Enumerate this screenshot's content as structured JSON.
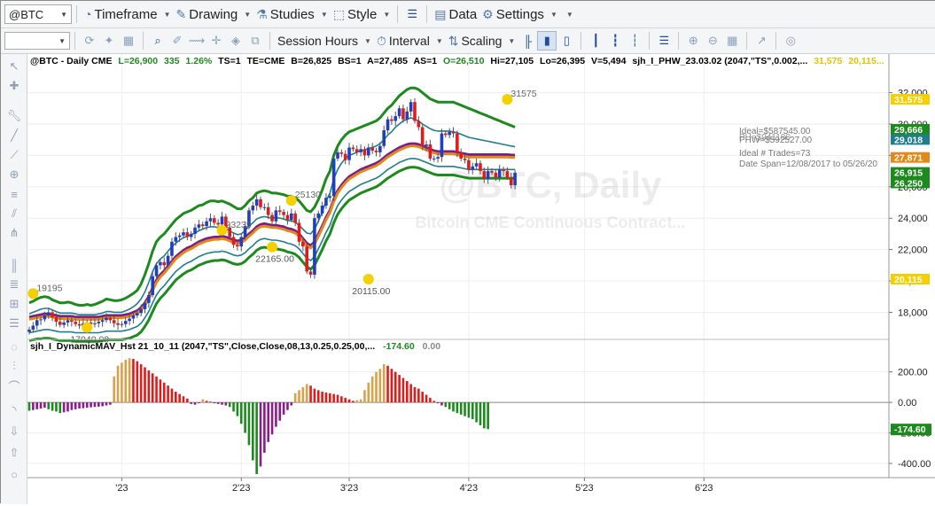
{
  "toolbar1": {
    "symbol": "@BTC",
    "menus": [
      {
        "label": "Timeframe",
        "icon": "clock-icon"
      },
      {
        "label": "Drawing",
        "icon": "pencil-icon"
      },
      {
        "label": "Studies",
        "icon": "flask-icon"
      },
      {
        "label": "Style",
        "icon": "style-icon"
      },
      {
        "label": "Data",
        "icon": "data-icon"
      },
      {
        "label": "Settings",
        "icon": "gear-icon"
      }
    ]
  },
  "toolbar2": {
    "session_hours": "Session Hours",
    "interval": "Interval",
    "scaling": "Scaling"
  },
  "status_line": {
    "symbol": "@BTC - Daily  CME",
    "last": "L=26,900",
    "chg": "335",
    "pct": "1.26%",
    "ts": "TS=1",
    "te": "TE=CME",
    "bid": "B=26,825",
    "bs": "BS=1",
    "ask": "A=27,485",
    "as": "AS=1",
    "open": "O=26,510",
    "hi": "Hi=27,105",
    "lo": "Lo=26,395",
    "vol": "V=5,494",
    "study": "sjh_I_PHW_23.03.02 (2047,\"TS\",0.002,...",
    "v1": "31,575",
    "v2": "20,115..."
  },
  "indicator_line": {
    "name": "sjh_I_DynamicMAV_Hst 21_10_11 (2047,\"TS\",Close,Close,08,13,0.25,0.25,00,...",
    "value": "-174.60",
    "zero": "0.00"
  },
  "watermark": {
    "main": "@BTC, Daily",
    "sub": "Bitcoin CME Continuous Contract..."
  },
  "stats_box": [
    "Ideal=$587545.00",
    "PHW=$592527.00",
    "Ideal # Trades=73",
    "Date Span=12/08/2017 to 05/26/20"
  ],
  "stats_overlap": "PH=$941180",
  "price_axis": {
    "ticks": [
      "32,000",
      "30,000",
      "28,000",
      "26,000",
      "24,000",
      "22,000",
      "20,000",
      "18,000"
    ],
    "markers": [
      {
        "label": "31,575",
        "price": 31575,
        "color": "#f5d000"
      },
      {
        "label": "29,666",
        "price": 29666,
        "color": "#1c8a1c"
      },
      {
        "label": "29,018",
        "price": 29018,
        "color": "#1f7d8c"
      },
      {
        "label": "27,871",
        "price": 27871,
        "color": "#e08a1c"
      },
      {
        "label": "26,915",
        "price": 26915,
        "color": "#1c8a1c"
      },
      {
        "label": "26,250",
        "price": 26250,
        "color": "#1c8a1c"
      },
      {
        "label": "20,115",
        "price": 20115,
        "color": "#f5d000"
      }
    ]
  },
  "indicator_axis": {
    "ticks": [
      "200.00",
      "0.00",
      "-200.00",
      "-400.00"
    ],
    "markers": [
      {
        "label": "0.00",
        "value": 0,
        "color": "#ffffff"
      },
      {
        "label": "-174.60",
        "value": -174.6,
        "color": "#1c8a1c"
      }
    ]
  },
  "time_axis": {
    "labels": [
      {
        "text": "'23",
        "day": 7
      },
      {
        "text": "2'23",
        "day": 38
      },
      {
        "text": "3'23",
        "day": 66
      },
      {
        "text": "4'23",
        "day": 97
      },
      {
        "text": "5'23",
        "day": 127
      },
      {
        "text": "6'23",
        "day": 158
      }
    ]
  },
  "swing_labels": [
    {
      "text": "19195",
      "day": -16,
      "price": 19195,
      "pos": "right"
    },
    {
      "text": "17040.00",
      "day": -2,
      "price": 17040,
      "pos": "below"
    },
    {
      "text": "23235",
      "day": 33,
      "price": 23235,
      "pos": "right"
    },
    {
      "text": "22165.00",
      "day": 46,
      "price": 22165,
      "pos": "below"
    },
    {
      "text": "25130",
      "day": 51,
      "price": 25130,
      "pos": "right"
    },
    {
      "text": "20115.00",
      "day": 71,
      "price": 20115,
      "pos": "below"
    },
    {
      "text": "31575",
      "day": 107,
      "price": 31575,
      "pos": "right"
    }
  ],
  "chart_data": {
    "type": "candlestick",
    "title": "@BTC - Daily CME",
    "price_range": [
      16500,
      33500
    ],
    "indicator_range": [
      -470,
      320
    ],
    "date_domain": [
      "2022-12-08",
      "2023-06-12"
    ],
    "colors": {
      "up": "#1f3fbf",
      "down": "#e01b1b",
      "outer_band": "#1c8a1c",
      "inner_band": "#1f7d8c",
      "ma_orange": "#e08a1c",
      "ma_purple": "#7b1c8c",
      "swing": "#f5d000"
    },
    "close_series": [
      16900,
      17150,
      17500,
      17550,
      17800,
      18000,
      17700,
      17400,
      17200,
      17350,
      17500,
      17400,
      17250,
      17150,
      17300,
      17350,
      17250,
      17300,
      17400,
      17500,
      17650,
      17500,
      17300,
      17200,
      17250,
      17450,
      17600,
      17800,
      17950,
      18200,
      18600,
      19100,
      20300,
      21000,
      21200,
      21000,
      21600,
      22500,
      22800,
      22900,
      23100,
      22800,
      23000,
      23400,
      23600,
      23500,
      23800,
      24000,
      23700,
      23600,
      24100,
      23400,
      22800,
      22300,
      22200,
      22800,
      23500,
      24500,
      24800,
      25200,
      24700,
      24700,
      24200,
      23800,
      24500,
      24400,
      24200,
      23900,
      24300,
      23700,
      22500,
      22200,
      20600,
      20400,
      24000,
      24300,
      24800,
      25300,
      25400,
      27800,
      28200,
      28100,
      27700,
      28500,
      28400,
      28200,
      28400,
      28000,
      28500,
      28300,
      28200,
      28600,
      29600,
      30300,
      30200,
      30500,
      31000,
      30300,
      30800,
      31400,
      30200,
      29800,
      28600,
      28700,
      27800,
      27800,
      27900,
      29400,
      29300,
      29500,
      29400,
      28200,
      27800,
      27700,
      27100,
      27300,
      27500,
      27000,
      26500,
      27000,
      26900,
      26600,
      27100,
      27000,
      26600,
      26100,
      26900
    ],
    "outer_upper": [
      18600,
      18700,
      18850,
      18950,
      19000,
      18950,
      18800,
      18700,
      18600,
      18600,
      18650,
      18600,
      18500,
      18450,
      18450,
      18500,
      18450,
      18500,
      18600,
      18700,
      18850,
      18800,
      18750,
      18750,
      18800,
      18900,
      19050,
      19200,
      19400,
      19800,
      20400,
      21100,
      21900,
      22500,
      22800,
      23000,
      23300,
      23600,
      23900,
      24100,
      24300,
      24400,
      24500,
      24650,
      24800,
      24850,
      25000,
      25100,
      25100,
      25050,
      25100,
      25000,
      24900,
      24750,
      24600,
      24600,
      24800,
      25100,
      25300,
      25600,
      25700,
      25750,
      25700,
      25600,
      25600,
      25550,
      25500,
      25400,
      25400,
      25300,
      25100,
      24800,
      24500,
      24400,
      24700,
      25200,
      25800,
      26500,
      27000,
      28000,
      28600,
      29000,
      29300,
      29500,
      29600,
      29700,
      29800,
      29900,
      30000,
      30100,
      30200,
      30400,
      30700,
      31000,
      31200,
      31500,
      31800,
      32000,
      32200,
      32300,
      32300,
      32200,
      32000,
      31800,
      31600,
      31500,
      31400,
      31400,
      31400,
      31400,
      31400,
      31300,
      31200,
      31100,
      31000,
      30900,
      30800,
      30700,
      30600,
      30500,
      30400,
      30300,
      30200,
      30100,
      30000,
      29900,
      29800
    ],
    "inner_upper": [
      17900,
      18000,
      18100,
      18200,
      18250,
      18250,
      18150,
      18050,
      17950,
      17950,
      17950,
      17950,
      17900,
      17850,
      17850,
      17850,
      17850,
      17850,
      17900,
      17950,
      18050,
      18050,
      18000,
      18000,
      18000,
      18100,
      18200,
      18350,
      18550,
      18850,
      19300,
      19900,
      20600,
      21100,
      21400,
      21600,
      21900,
      22200,
      22400,
      22600,
      22750,
      22850,
      22950,
      23050,
      23200,
      23300,
      23400,
      23450,
      23450,
      23400,
      23450,
      23350,
      23200,
      23050,
      22950,
      23000,
      23200,
      23500,
      23700,
      23950,
      24050,
      24100,
      24050,
      24000,
      24050,
      24000,
      23950,
      23850,
      23850,
      23750,
      23550,
      23300,
      23050,
      23000,
      23300,
      23800,
      24400,
      25100,
      25600,
      26500,
      27100,
      27500,
      27800,
      28000,
      28100,
      28200,
      28300,
      28350,
      28450,
      28500,
      28600,
      28750,
      29000,
      29300,
      29500,
      29800,
      30000,
      30200,
      30300,
      30400,
      30300,
      30200,
      30000,
      29850,
      29700,
      29600,
      29550,
      29550,
      29550,
      29550,
      29500,
      29450,
      29350,
      29250,
      29150,
      29100,
      29050,
      29000,
      28950,
      28900,
      28850,
      28800,
      28750,
      28700,
      28650,
      28600,
      28550
    ],
    "ma_orange": [
      17550,
      17600,
      17650,
      17700,
      17750,
      17750,
      17700,
      17650,
      17600,
      17600,
      17600,
      17600,
      17550,
      17550,
      17550,
      17550,
      17550,
      17550,
      17550,
      17600,
      17650,
      17650,
      17650,
      17650,
      17650,
      17700,
      17750,
      17850,
      17950,
      18150,
      18450,
      18850,
      19400,
      19900,
      20250,
      20500,
      20800,
      21100,
      21400,
      21600,
      21800,
      21950,
      22050,
      22200,
      22350,
      22450,
      22550,
      22600,
      22650,
      22650,
      22700,
      22650,
      22550,
      22450,
      22400,
      22450,
      22600,
      22850,
      23050,
      23300,
      23450,
      23500,
      23450,
      23400,
      23400,
      23350,
      23300,
      23200,
      23150,
      23050,
      22850,
      22550,
      22250,
      22100,
      22350,
      22850,
      23350,
      23900,
      24350,
      25050,
      25600,
      25950,
      26250,
      26500,
      26650,
      26800,
      26950,
      27050,
      27150,
      27250,
      27350,
      27500,
      27700,
      27900,
      28050,
      28200,
      28350,
      28450,
      28550,
      28600,
      28600,
      28550,
      28450,
      28350,
      28250,
      28150,
      28100,
      28100,
      28100,
      28100,
      28100,
      28050,
      28000,
      27950,
      27900,
      27900,
      27900,
      27900,
      27900,
      27900,
      27900,
      27900,
      27900,
      27900,
      27900,
      27880,
      27871
    ],
    "inner_lower": [
      16700,
      16750,
      16800,
      16850,
      16900,
      16900,
      16850,
      16800,
      16750,
      16750,
      16750,
      16750,
      16700,
      16700,
      16700,
      16700,
      16700,
      16700,
      16700,
      16750,
      16800,
      16800,
      16800,
      16800,
      16800,
      16850,
      16900,
      17000,
      17100,
      17300,
      17650,
      18050,
      18600,
      19100,
      19450,
      19700,
      20000,
      20300,
      20600,
      20800,
      21000,
      21150,
      21250,
      21400,
      21550,
      21650,
      21750,
      21800,
      21850,
      21850,
      21900,
      21850,
      21750,
      21650,
      21600,
      21650,
      21800,
      22050,
      22250,
      22500,
      22650,
      22700,
      22650,
      22600,
      22600,
      22550,
      22500,
      22400,
      22350,
      22250,
      22050,
      21750,
      21450,
      21300,
      21550,
      22050,
      22550,
      23100,
      23550,
      24250,
      24800,
      25150,
      25450,
      25700,
      25850,
      26000,
      26150,
      26250,
      26350,
      26450,
      26550,
      26700,
      26900,
      27100,
      27250,
      27400,
      27550,
      27650,
      27750,
      27800,
      27800,
      27750,
      27650,
      27550,
      27450,
      27350,
      27300,
      27300,
      27300,
      27300,
      27300,
      27250,
      27200,
      27150,
      27100,
      27100,
      27100,
      27100,
      27100,
      27100,
      27100,
      27100,
      27100,
      27100,
      27100,
      27100,
      27100
    ],
    "outer_lower": [
      16200,
      16250,
      16300,
      16300,
      16350,
      16350,
      16300,
      16250,
      16200,
      16200,
      16200,
      16200,
      16150,
      16150,
      16150,
      16150,
      16150,
      16150,
      16150,
      16200,
      16250,
      16250,
      16250,
      16250,
      16250,
      16300,
      16350,
      16450,
      16550,
      16750,
      17100,
      17500,
      18050,
      18550,
      18900,
      19150,
      19450,
      19750,
      20050,
      20250,
      20450,
      20600,
      20700,
      20850,
      21000,
      21100,
      21200,
      21250,
      21300,
      21300,
      21350,
      21300,
      21200,
      21100,
      21050,
      21100,
      21250,
      21500,
      21700,
      21950,
      22100,
      22150,
      22100,
      22050,
      22050,
      22000,
      21950,
      21850,
      21800,
      21700,
      21500,
      21200,
      20900,
      20750,
      21000,
      21500,
      22000,
      22550,
      23000,
      23700,
      24250,
      24600,
      24900,
      25150,
      25300,
      25450,
      25600,
      25700,
      25800,
      25900,
      26000,
      26150,
      26350,
      26550,
      26700,
      26850,
      27000,
      27100,
      27200,
      27250,
      27250,
      27200,
      27100,
      27000,
      26900,
      26800,
      26750,
      26750,
      26750,
      26750,
      26750,
      26700,
      26650,
      26600,
      26550,
      26550,
      26550,
      26550,
      26550,
      26550,
      26550,
      26550,
      26550,
      26550,
      26550,
      26550,
      26550
    ],
    "histogram": [
      -55,
      -50,
      -45,
      -40,
      -35,
      -45,
      -55,
      -60,
      -70,
      -65,
      -60,
      -50,
      -45,
      -40,
      -38,
      -35,
      -32,
      -30,
      -28,
      -25,
      -20,
      -15,
      170,
      240,
      260,
      280,
      290,
      285,
      270,
      250,
      230,
      210,
      190,
      170,
      150,
      130,
      110,
      90,
      70,
      55,
      40,
      25,
      -10,
      -15,
      -5,
      20,
      10,
      5,
      -5,
      -10,
      -15,
      -20,
      -30,
      -60,
      -90,
      -140,
      -200,
      -280,
      -380,
      -470,
      -420,
      -330,
      -260,
      -210,
      -160,
      -120,
      -80,
      -50,
      -20,
      60,
      80,
      100,
      120,
      110,
      90,
      80,
      70,
      65,
      60,
      55,
      50,
      40,
      30,
      20,
      10,
      15,
      20,
      80,
      130,
      170,
      200,
      220,
      250,
      240,
      220,
      200,
      180,
      160,
      140,
      120,
      100,
      90,
      70,
      50,
      30,
      10,
      -5,
      -20,
      -30,
      -45,
      -60,
      -70,
      -80,
      -90,
      -100,
      -110,
      -130,
      -150,
      -170,
      -175
    ],
    "hist_start_day": 0
  }
}
